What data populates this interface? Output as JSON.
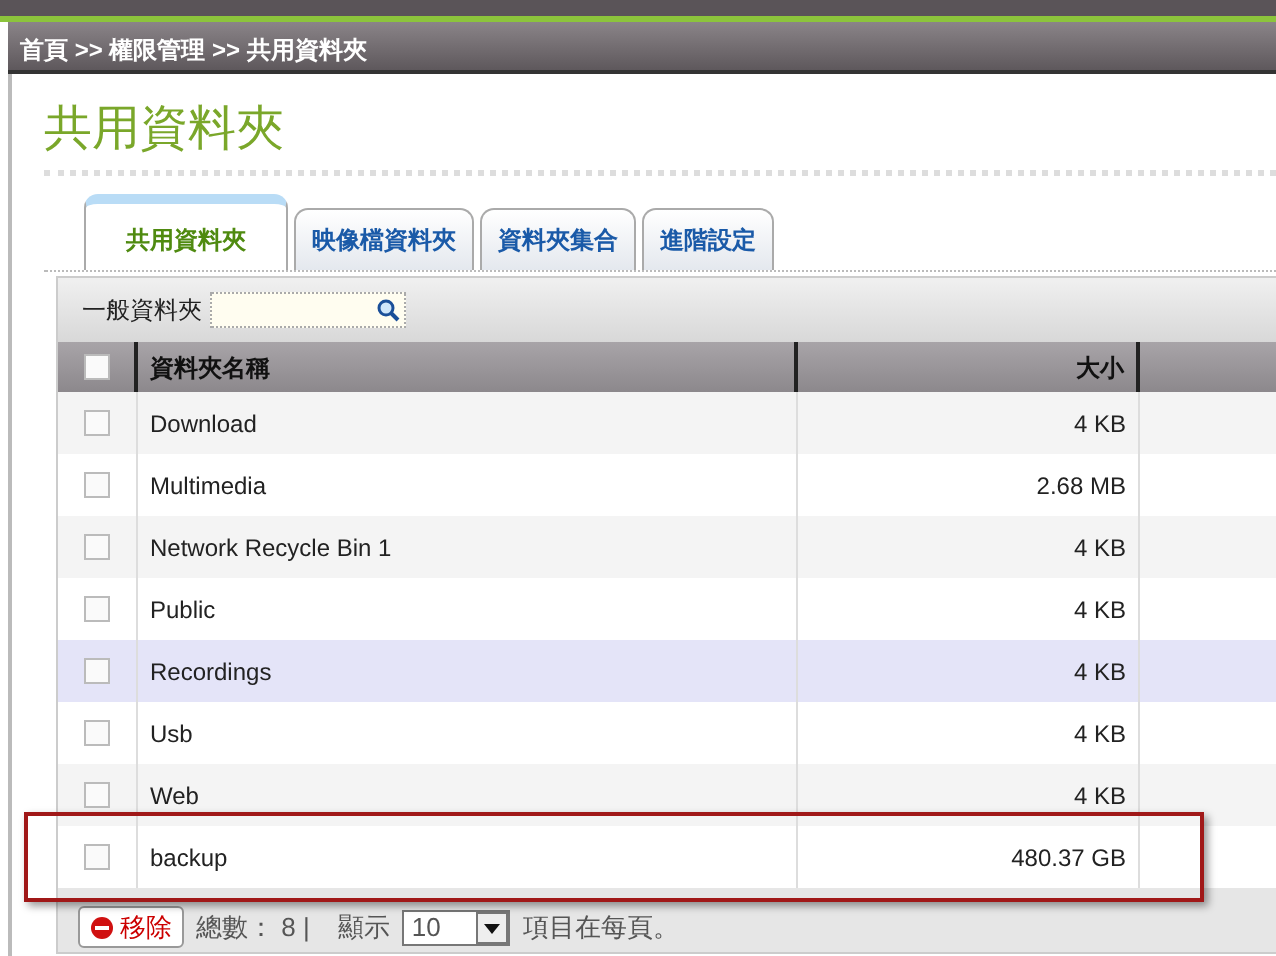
{
  "breadcrumb": "首頁 >> 權限管理 >> 共用資料夾",
  "title": "共用資料夾",
  "tabs": [
    {
      "label": "共用資料夾",
      "selected": true
    },
    {
      "label": "映像檔資料夾",
      "selected": false
    },
    {
      "label": "資料夾集合",
      "selected": false
    },
    {
      "label": "進階設定",
      "selected": false
    }
  ],
  "filter": {
    "label": "一般資料夾"
  },
  "table": {
    "columns": [
      "資料夾名稱",
      "大小"
    ],
    "select_all_checked": false,
    "rows": [
      {
        "name": "Download",
        "size": "4 KB",
        "checked": false,
        "highlighted": false,
        "annotated": false
      },
      {
        "name": "Multimedia",
        "size": "2.68 MB",
        "checked": false,
        "highlighted": false,
        "annotated": false
      },
      {
        "name": "Network Recycle Bin 1",
        "size": "4 KB",
        "checked": false,
        "highlighted": false,
        "annotated": false
      },
      {
        "name": "Public",
        "size": "4 KB",
        "checked": false,
        "highlighted": false,
        "annotated": false
      },
      {
        "name": "Recordings",
        "size": "4 KB",
        "checked": false,
        "highlighted": true,
        "annotated": false
      },
      {
        "name": "Usb",
        "size": "4 KB",
        "checked": false,
        "highlighted": false,
        "annotated": false
      },
      {
        "name": "Web",
        "size": "4 KB",
        "checked": false,
        "highlighted": false,
        "annotated": false
      },
      {
        "name": "backup",
        "size": "480.37 GB",
        "checked": false,
        "highlighted": false,
        "annotated": true
      }
    ]
  },
  "footer": {
    "remove_button": "移除",
    "total": "總數： 8 |",
    "show_label": "顯示",
    "page_size": "10",
    "per_page_label": "項目在每頁。"
  }
}
